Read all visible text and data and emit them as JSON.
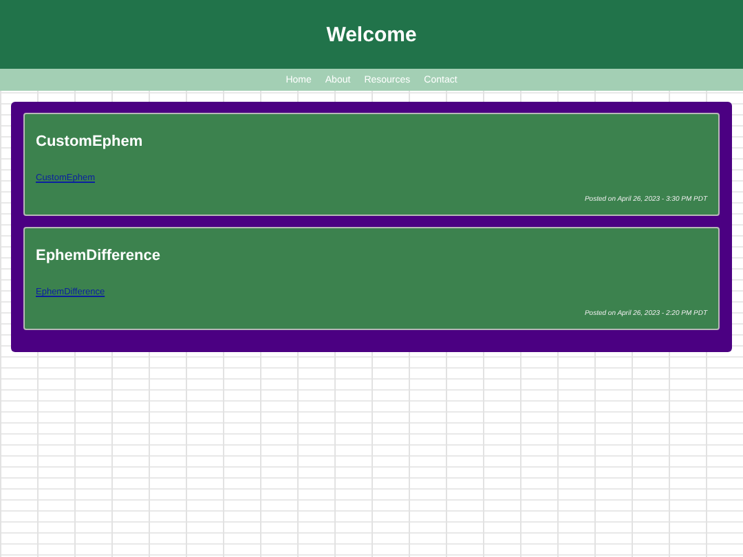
{
  "header": {
    "title": "Welcome"
  },
  "nav": [
    "Home",
    "About",
    "Resources",
    "Contact"
  ],
  "posts": [
    {
      "title": "CustomEphem",
      "link": "CustomEphem",
      "posted": "Posted on April 26, 2023 - 3:30 PM PDT"
    },
    {
      "title": "EphemDifference",
      "link": "EphemDifference",
      "posted": "Posted on April 26, 2023 - 2:20 PM PDT"
    }
  ]
}
